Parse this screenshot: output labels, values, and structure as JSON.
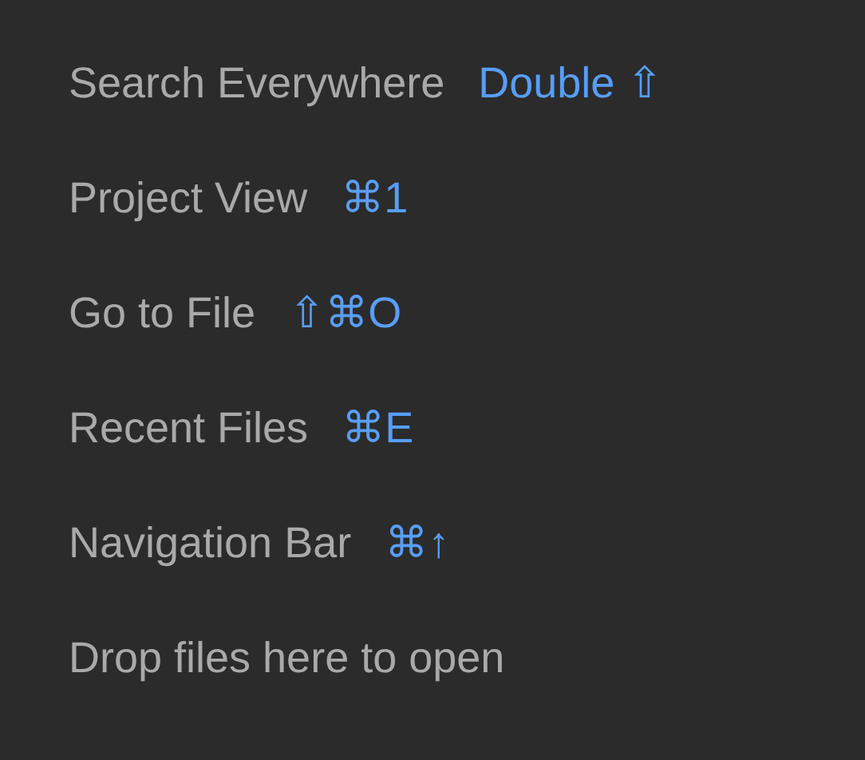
{
  "hints": [
    {
      "label": "Search Everywhere",
      "shortcut": "Double ⇧"
    },
    {
      "label": "Project View",
      "shortcut": "⌘1"
    },
    {
      "label": "Go to File",
      "shortcut": "⇧⌘O"
    },
    {
      "label": "Recent Files",
      "shortcut": "⌘E"
    },
    {
      "label": "Navigation Bar",
      "shortcut": "⌘↑"
    },
    {
      "label": "Drop files here to open"
    }
  ]
}
